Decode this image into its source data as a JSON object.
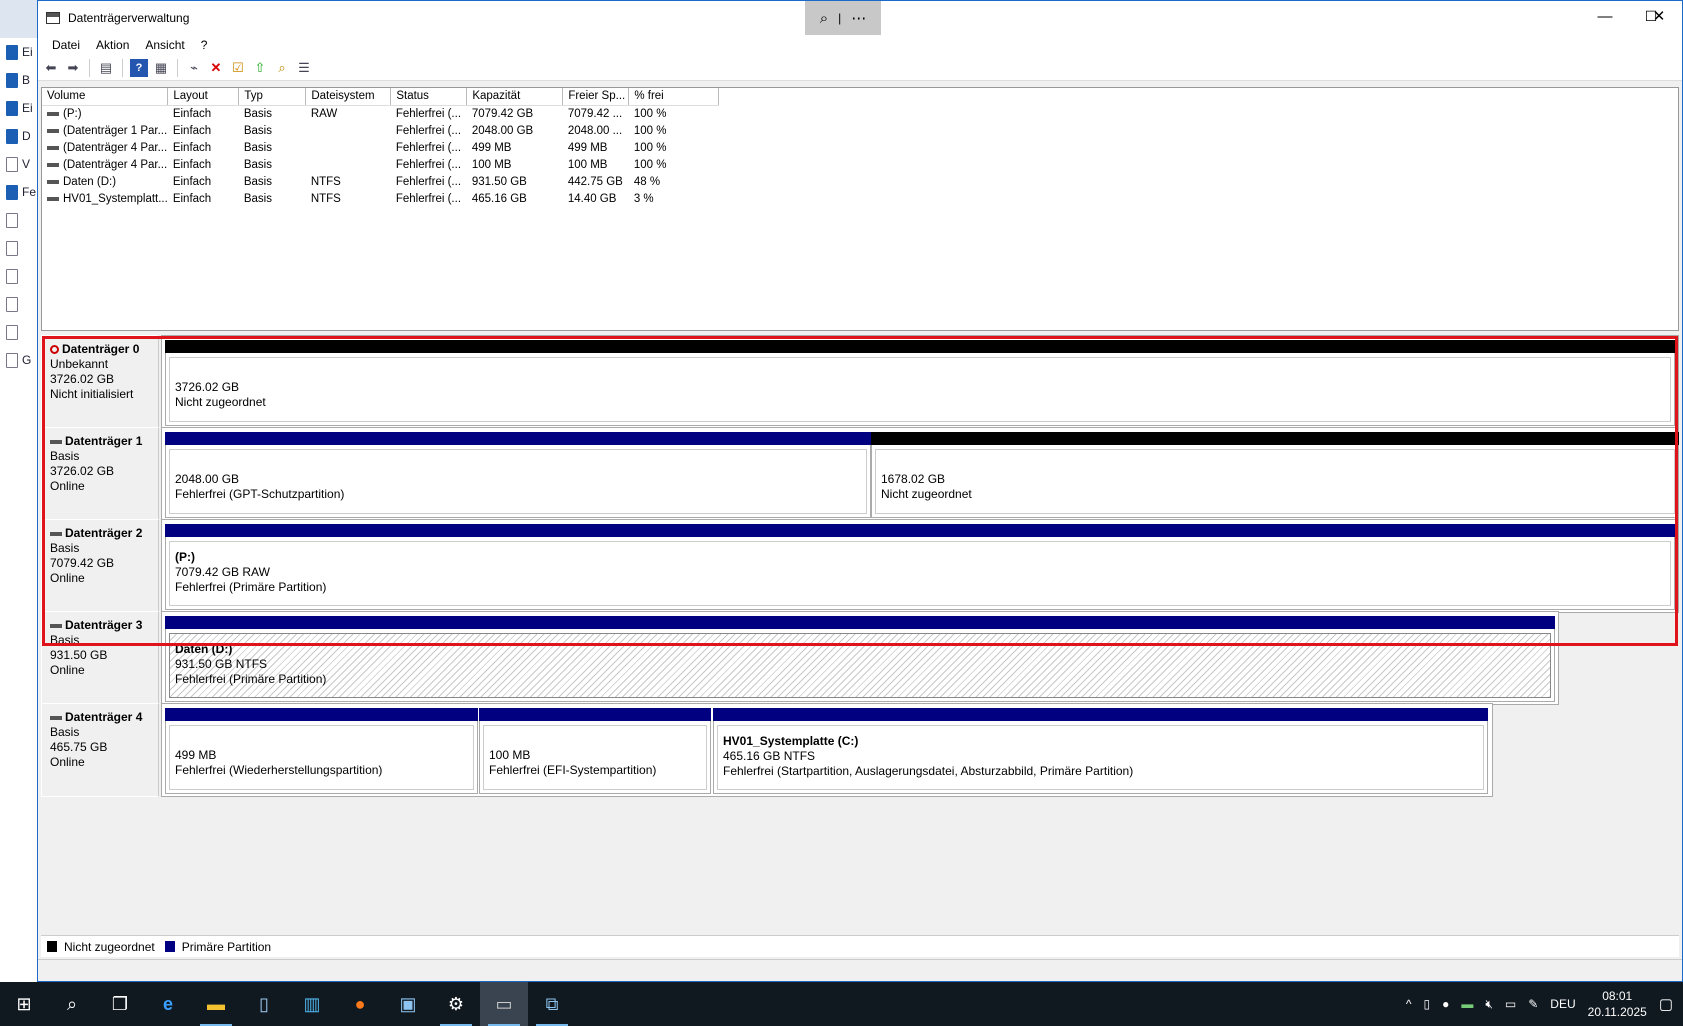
{
  "window": {
    "title": "Datenträgerverwaltung",
    "controls": {
      "minimize": "—",
      "maximize": "☐",
      "close": "✕"
    },
    "zoom": {
      "zoom_icon": "⌕",
      "divider": "|",
      "more": "⋯"
    }
  },
  "menu": [
    "Datei",
    "Aktion",
    "Ansicht",
    "?"
  ],
  "toolbar": [
    "back-icon",
    "forward-icon",
    "show-hide-console-tree-icon",
    "help-icon",
    "properties-icon",
    "connect-icon",
    "delete-icon",
    "check-icon",
    "import-icon",
    "search-icon",
    "list-icon"
  ],
  "background_app": {
    "items": [
      {
        "label": "Ei",
        "icon": "book-icon"
      },
      {
        "label": "B",
        "icon": "book-icon"
      },
      {
        "label": "Ei",
        "icon": "book-icon"
      },
      {
        "label": "D",
        "icon": "book-icon"
      },
      {
        "label": "V",
        "icon": "document-icon"
      },
      {
        "label": "Fe",
        "icon": "book-icon"
      },
      {
        "label": "",
        "icon": "document-icon"
      },
      {
        "label": "",
        "icon": "document-icon"
      },
      {
        "label": "",
        "icon": "document-icon"
      },
      {
        "label": "",
        "icon": "document-icon"
      },
      {
        "label": "",
        "icon": "document-icon"
      },
      {
        "label": "G",
        "icon": "document-icon"
      }
    ]
  },
  "volumes": {
    "columns": [
      "Volume",
      "Layout",
      "Typ",
      "Dateisystem",
      "Status",
      "Kapazität",
      "Freier Sp...",
      "% frei"
    ],
    "rows": [
      [
        "(P:)",
        "Einfach",
        "Basis",
        "RAW",
        "Fehlerfrei (...",
        "7079.42 GB",
        "7079.42 ...",
        "100 %"
      ],
      [
        "(Datenträger 1 Par...",
        "Einfach",
        "Basis",
        "",
        "Fehlerfrei (...",
        "2048.00 GB",
        "2048.00 ...",
        "100 %"
      ],
      [
        "(Datenträger 4 Par...",
        "Einfach",
        "Basis",
        "",
        "Fehlerfrei (...",
        "499 MB",
        "499 MB",
        "100 %"
      ],
      [
        "(Datenträger 4 Par...",
        "Einfach",
        "Basis",
        "",
        "Fehlerfrei (...",
        "100 MB",
        "100 MB",
        "100 %"
      ],
      [
        "Daten (D:)",
        "Einfach",
        "Basis",
        "NTFS",
        "Fehlerfrei (...",
        "931.50 GB",
        "442.75 GB",
        "48 %"
      ],
      [
        "HV01_Systemplatt...",
        "Einfach",
        "Basis",
        "NTFS",
        "Fehlerfrei (...",
        "465.16 GB",
        "14.40 GB",
        "3 %"
      ]
    ]
  },
  "disks": [
    {
      "name": "Datenträger 0",
      "type": "Unbekannt",
      "size": "3726.02 GB",
      "state": "Nicht initialisiert",
      "warning": true,
      "partitions": [
        {
          "title": "",
          "size": "3726.02 GB",
          "status": "Nicht zugeordnet",
          "kind": "unallocated"
        }
      ]
    },
    {
      "name": "Datenträger 1",
      "type": "Basis",
      "size": "3726.02 GB",
      "state": "Online",
      "warning": false,
      "partitions": [
        {
          "title": "",
          "size": "2048.00 GB",
          "status": "Fehlerfrei (GPT-Schutzpartition)",
          "kind": "primary"
        },
        {
          "title": "",
          "size": "1678.02 GB",
          "status": "Nicht zugeordnet",
          "kind": "unallocated"
        }
      ]
    },
    {
      "name": "Datenträger 2",
      "type": "Basis",
      "size": "7079.42 GB",
      "state": "Online",
      "warning": false,
      "partitions": [
        {
          "title": "(P:)",
          "size": "7079.42 GB RAW",
          "status": "Fehlerfrei (Primäre Partition)",
          "kind": "primary"
        }
      ]
    },
    {
      "name": "Datenträger 3",
      "type": "Basis",
      "size": "931.50 GB",
      "state": "Online",
      "warning": false,
      "partitions": [
        {
          "title": "Daten  (D:)",
          "size": "931.50 GB NTFS",
          "status": "Fehlerfrei (Primäre Partition)",
          "kind": "primary-selected"
        }
      ]
    },
    {
      "name": "Datenträger 4",
      "type": "Basis",
      "size": "465.75 GB",
      "state": "Online",
      "warning": false,
      "partitions": [
        {
          "title": "",
          "size": "499 MB",
          "status": "Fehlerfrei (Wiederherstellungspartition)",
          "kind": "primary"
        },
        {
          "title": "",
          "size": "100 MB",
          "status": "Fehlerfrei (EFI-Systempartition)",
          "kind": "primary"
        },
        {
          "title": "HV01_Systemplatte  (C:)",
          "size": "465.16 GB NTFS",
          "status": "Fehlerfrei (Startpartition, Auslagerungsdatei, Absturzabbild, Primäre Partition)",
          "kind": "primary"
        }
      ]
    }
  ],
  "legend": [
    {
      "label": "Nicht zugeordnet",
      "color": "#000000"
    },
    {
      "label": "Primäre Partition",
      "color": "#000080"
    }
  ],
  "colors": {
    "unallocated": "#000000",
    "primary": "#000080",
    "highlight": "#e0131b"
  },
  "taskbar": {
    "apps": [
      "windows-start-icon",
      "search-icon",
      "task-view-icon",
      "internet-explorer-icon",
      "file-explorer-icon",
      "notepad-icon",
      "server-manager-icon",
      "firefox-icon",
      "remote-desktop-icon",
      "settings-icon",
      "disk-management-icon",
      "network-icon"
    ],
    "tray": {
      "language": "DEU",
      "time": "08:01",
      "date": "20.11.2025"
    }
  }
}
